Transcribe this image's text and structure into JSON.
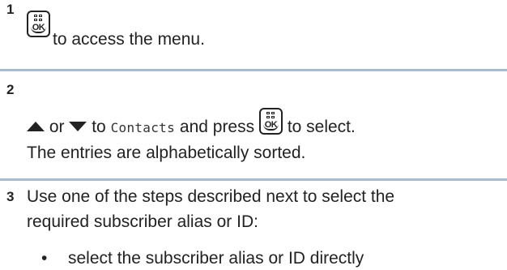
{
  "steps": [
    {
      "number": "1",
      "text": "to access the menu."
    },
    {
      "number": "2",
      "or_text": "or",
      "to_text": "to",
      "menu_item": "Contacts",
      "press_text": "and press",
      "select_text": "to select.",
      "note": "The entries are alphabetically sorted."
    },
    {
      "number": "3",
      "line1": "Use one of the steps described next to select the",
      "line2": "required subscriber alias or ID:",
      "bullet": "•",
      "bullet_text": "select the subscriber alias or ID directly"
    }
  ],
  "icons": {
    "ok_button_label": "OK"
  },
  "colors": {
    "divider": "#a9bccb",
    "text": "#222222"
  }
}
